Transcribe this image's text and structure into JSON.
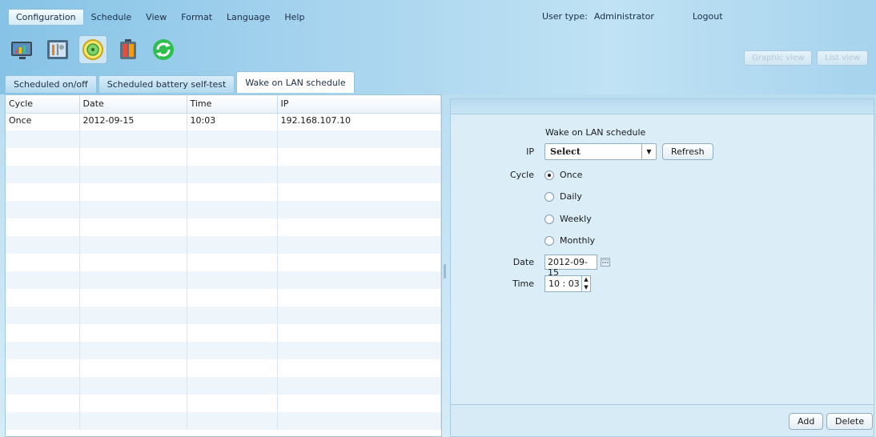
{
  "menu": {
    "items": [
      "Configuration",
      "Schedule",
      "View",
      "Format",
      "Language",
      "Help"
    ],
    "active_index": 0
  },
  "user": {
    "type_label": "User type:",
    "type_value": "Administrator",
    "logout": "Logout"
  },
  "toolbar": {
    "icons": [
      "monitor-chart-icon",
      "tools-config-icon",
      "schedule-clock-icon",
      "battery-icon",
      "refresh-icon"
    ],
    "active_index": 2
  },
  "view_buttons": {
    "graphic": "Graphic view",
    "list": "List view"
  },
  "tabs": {
    "items": [
      "Scheduled on/off",
      "Scheduled battery self-test",
      "Wake on LAN schedule"
    ],
    "active_index": 2
  },
  "table": {
    "columns": [
      "Cycle",
      "Date",
      "Time",
      "IP"
    ],
    "rows": [
      [
        "Once",
        "2012-09-15",
        "10:03",
        "192.168.107.10"
      ]
    ]
  },
  "form": {
    "title": "Wake on LAN schedule",
    "ip_label": "IP",
    "ip_select_value": "Select",
    "refresh_button": "Refresh",
    "cycle_label": "Cycle",
    "cycle_options": [
      "Once",
      "Daily",
      "Weekly",
      "Monthly"
    ],
    "cycle_selected": "Once",
    "date_label": "Date",
    "date_value": "2012-09-15",
    "time_label": "Time",
    "time_value": "10 : 03",
    "add_button": "Add",
    "delete_button": "Delete"
  },
  "colors": {
    "accent": "#8cc6e6",
    "panel": "#dbeef8"
  }
}
